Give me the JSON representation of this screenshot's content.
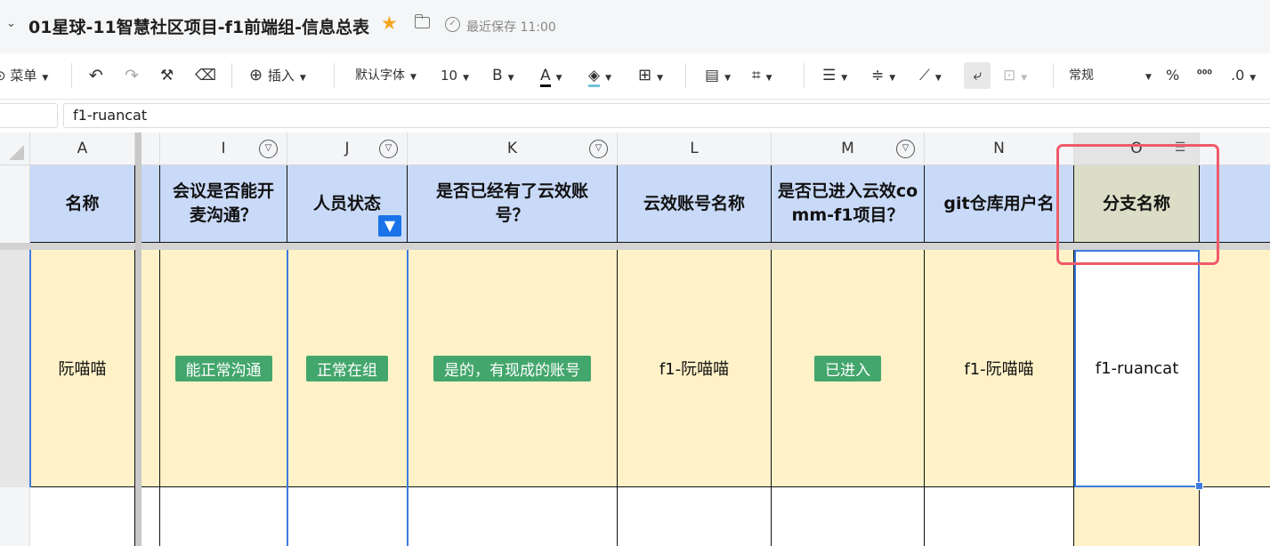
{
  "doc": {
    "title": "01星球-11智慧社区项目-f1前端组-信息总表",
    "save_status": "最近保存 11:00"
  },
  "toolbar": {
    "menu": "菜单",
    "insert": "插入",
    "font": "默认字体",
    "font_size": "10",
    "bold": "B",
    "font_color": "A",
    "number_format": "常规",
    "percent": "%",
    "thousands": "⁰⁰⁰",
    "decimal": ".0"
  },
  "formula_bar": {
    "cell_ref": "",
    "value": "f1-ruancat"
  },
  "columns": [
    "A",
    "I",
    "J",
    "K",
    "L",
    "M",
    "N",
    "O"
  ],
  "header_row": [
    "名称",
    "会议是否能开麦沟通？",
    "人员状态",
    "是否已经有了云效账号？",
    "云效账号名称",
    "是否已进入云效comm-f1项目？",
    "git仓库用户名",
    "分支名称"
  ],
  "data_row": {
    "name": "阮喵喵",
    "can_talk": "能正常沟通",
    "status": "正常在组",
    "has_account": "是的，有现成的账号",
    "account_name": "f1-阮喵喵",
    "joined_project": "已进入",
    "git_user": "f1-阮喵喵",
    "branch": "f1-ruancat"
  },
  "colors": {
    "header_fill": "#c9daf8",
    "data_fill": "#fff2c8",
    "tag_green": "#43a66c",
    "selection_blue": "#3d7be0",
    "highlight_red": "#ef5a6a",
    "star": "#f5a623"
  }
}
